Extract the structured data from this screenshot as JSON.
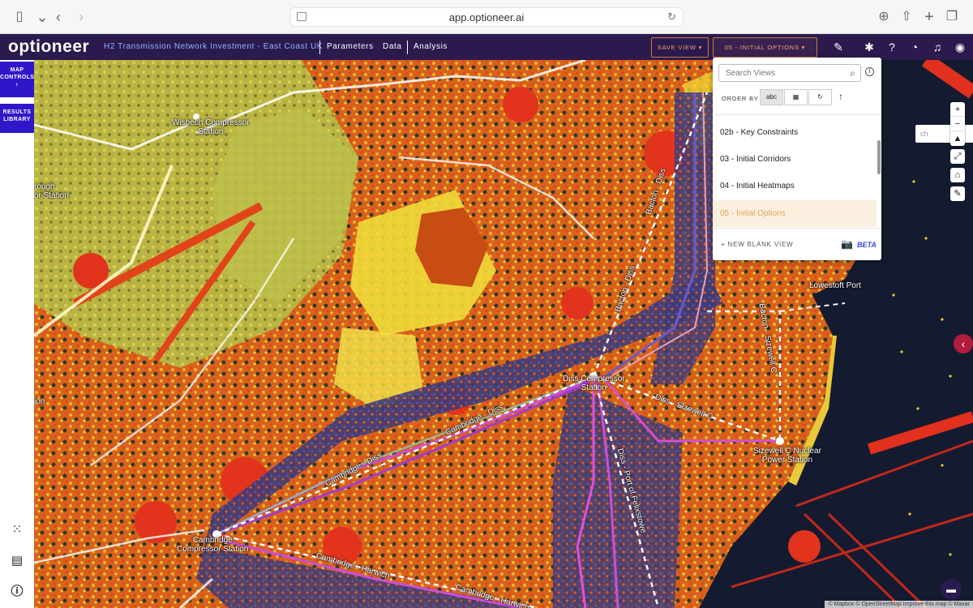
{
  "browser": {
    "url": "app.optioneer.ai"
  },
  "header": {
    "logo": "optioneer",
    "project_title": "H2 Transmission Network Investment - East Coast UK",
    "nav": [
      "Parameters",
      "Data",
      "Analysis"
    ],
    "save_view": "SAVE VIEW ▾",
    "current_view": "05 - INITIAL OPTIONS ▾"
  },
  "sidebar": {
    "map_controls": [
      "MAP",
      "CONTROLS",
      "›"
    ],
    "results_library": [
      "RESULTS",
      "LIBRARY"
    ]
  },
  "views_dropdown": {
    "search_placeholder": "Search Views",
    "order_by_label": "ORDER BY",
    "order_options": [
      "abc",
      "date",
      "recent"
    ],
    "items": [
      {
        "label": "02b - Key Constraints",
        "selected": false
      },
      {
        "label": "03 - Initial Corridors",
        "selected": false
      },
      {
        "label": "04 - Initial Heatmaps",
        "selected": false
      },
      {
        "label": "05 - Initial Options",
        "selected": true
      }
    ],
    "new_blank_view": "+  NEW BLANK VIEW",
    "beta": "BETA"
  },
  "map": {
    "search_behind": "ch",
    "labels": {
      "wisbech": "Wisbech Compressor\nStation",
      "peterborough": "rough\nor Station",
      "diss": "Diss Compressor\nStation",
      "sizewell": "Sizewell C Nuclear\nPower Station",
      "cambridge": "Cambridge\nCompressor Station",
      "lowestoft": "Lowestoft Port",
      "ion": "ion"
    },
    "routes": {
      "cambridge_diss_1": "Cambridge - Diss",
      "cambridge_diss_2": "Cambridge - Diss",
      "cambridge_harwich_1": "Cambridge - Harwich",
      "cambridge_harwich_2": "Cambridge - Harwich",
      "bacton_diss_1": "Bacton - Diss",
      "bacton_diss_2": "Bacton - Diss",
      "bacton_sizewell": "Bacton - Sizewell C",
      "diss_sizewell": "Diss - Sizewell C",
      "diss_felixstowe": "Diss - Port of Felixstowe"
    },
    "attribution": "© Mapbox © OpenStreetMap  Improve this map © Maxar"
  }
}
